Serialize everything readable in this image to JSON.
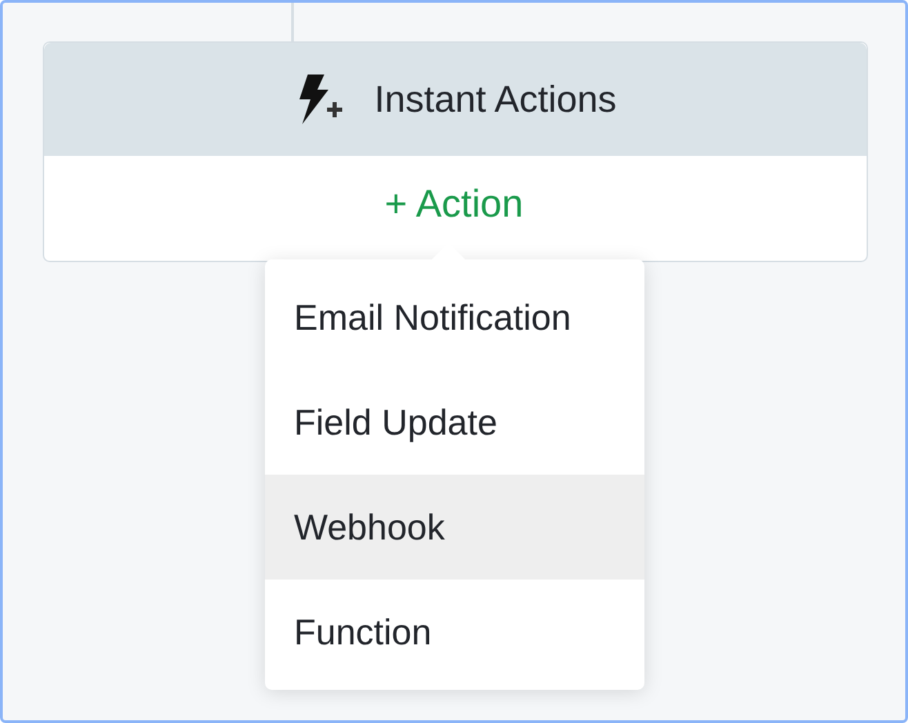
{
  "card": {
    "title": "Instant Actions",
    "add_action": "+ Action"
  },
  "menu": {
    "open": true,
    "items": [
      {
        "label": "Email Notification",
        "highlighted": false
      },
      {
        "label": "Field Update",
        "highlighted": false
      },
      {
        "label": "Webhook",
        "highlighted": true
      },
      {
        "label": "Function",
        "highlighted": false
      }
    ]
  }
}
